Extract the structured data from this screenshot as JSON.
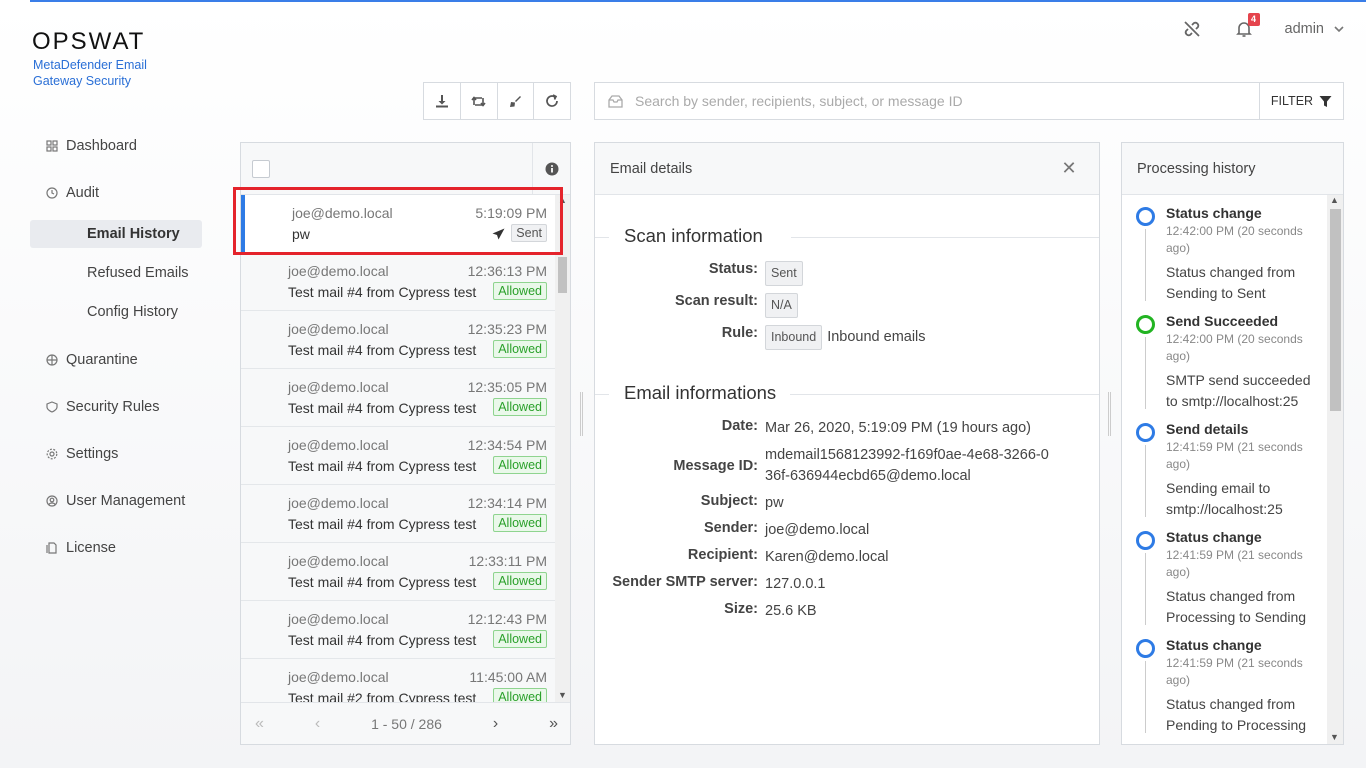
{
  "brand": {
    "logo": "OPSWAT",
    "product": "MetaDefender Email Gateway Security"
  },
  "header": {
    "notification_count": "4",
    "user": "admin"
  },
  "nav": {
    "dashboard": "Dashboard",
    "audit": "Audit",
    "email_history": "Email History",
    "refused_emails": "Refused Emails",
    "config_history": "Config History",
    "quarantine": "Quarantine",
    "security_rules": "Security Rules",
    "settings": "Settings",
    "user_management": "User Management",
    "license": "License"
  },
  "search": {
    "placeholder": "Search by sender, recipients, subject, or message ID",
    "filter_label": "FILTER"
  },
  "emails": [
    {
      "from": "joe@demo.local",
      "time": "5:19:09 PM",
      "subject": "pw",
      "status": "Sent"
    },
    {
      "from": "joe@demo.local",
      "time": "12:36:13 PM",
      "subject": "Test mail #4 from Cypress test",
      "status": "Allowed"
    },
    {
      "from": "joe@demo.local",
      "time": "12:35:23 PM",
      "subject": "Test mail #4 from Cypress test",
      "status": "Allowed"
    },
    {
      "from": "joe@demo.local",
      "time": "12:35:05 PM",
      "subject": "Test mail #4 from Cypress test",
      "status": "Allowed"
    },
    {
      "from": "joe@demo.local",
      "time": "12:34:54 PM",
      "subject": "Test mail #4 from Cypress test",
      "status": "Allowed"
    },
    {
      "from": "joe@demo.local",
      "time": "12:34:14 PM",
      "subject": "Test mail #4 from Cypress test",
      "status": "Allowed"
    },
    {
      "from": "joe@demo.local",
      "time": "12:33:11 PM",
      "subject": "Test mail #4 from Cypress test",
      "status": "Allowed"
    },
    {
      "from": "joe@demo.local",
      "time": "12:12:43 PM",
      "subject": "Test mail #4 from Cypress test",
      "status": "Allowed"
    },
    {
      "from": "joe@demo.local",
      "time": "11:45:00 AM",
      "subject": "Test mail #2 from Cypress test",
      "status": "Allowed"
    }
  ],
  "pagination": {
    "range": "1 - 50 / 286"
  },
  "details": {
    "title": "Email details",
    "scan_section": "Scan information",
    "status_label": "Status:",
    "status_value": "Sent",
    "scan_result_label": "Scan result:",
    "scan_result_value": "N/A",
    "rule_label": "Rule:",
    "rule_tag": "Inbound",
    "rule_value": "Inbound emails",
    "info_section": "Email informations",
    "date_label": "Date:",
    "date_value": "Mar 26, 2020, 5:19:09 PM (19 hours ago)",
    "message_id_label": "Message ID:",
    "message_id_value": "mdemail1568123992-f169f0ae-4e68-3266-036f-636944ecbd65@demo.local",
    "subject_label": "Subject:",
    "subject_value": "pw",
    "sender_label": "Sender:",
    "sender_value": "joe@demo.local",
    "recipient_label": "Recipient:",
    "recipient_value": "Karen@demo.local",
    "smtp_label": "Sender SMTP server:",
    "smtp_value": "127.0.0.1",
    "size_label": "Size:",
    "size_value": "25.6 KB"
  },
  "history": {
    "title": "Processing history",
    "items": [
      {
        "title": "Status change",
        "when": "12:42:00 PM (20 seconds ago)",
        "desc": "Status changed from Sending to Sent",
        "color": "#2e7be5"
      },
      {
        "title": "Send Succeeded",
        "when": "12:42:00 PM (20 seconds ago)",
        "desc": "SMTP send succeeded to smtp://localhost:25",
        "color": "#22b422"
      },
      {
        "title": "Send details",
        "when": "12:41:59 PM (21 seconds ago)",
        "desc": "Sending email to smtp://localhost:25",
        "color": "#2e7be5"
      },
      {
        "title": "Status change",
        "when": "12:41:59 PM (21 seconds ago)",
        "desc": "Status changed from Processing to Sending",
        "color": "#2e7be5"
      },
      {
        "title": "Status change",
        "when": "12:41:59 PM (21 seconds ago)",
        "desc": "Status changed from Pending to Processing",
        "color": "#2e7be5"
      }
    ]
  }
}
